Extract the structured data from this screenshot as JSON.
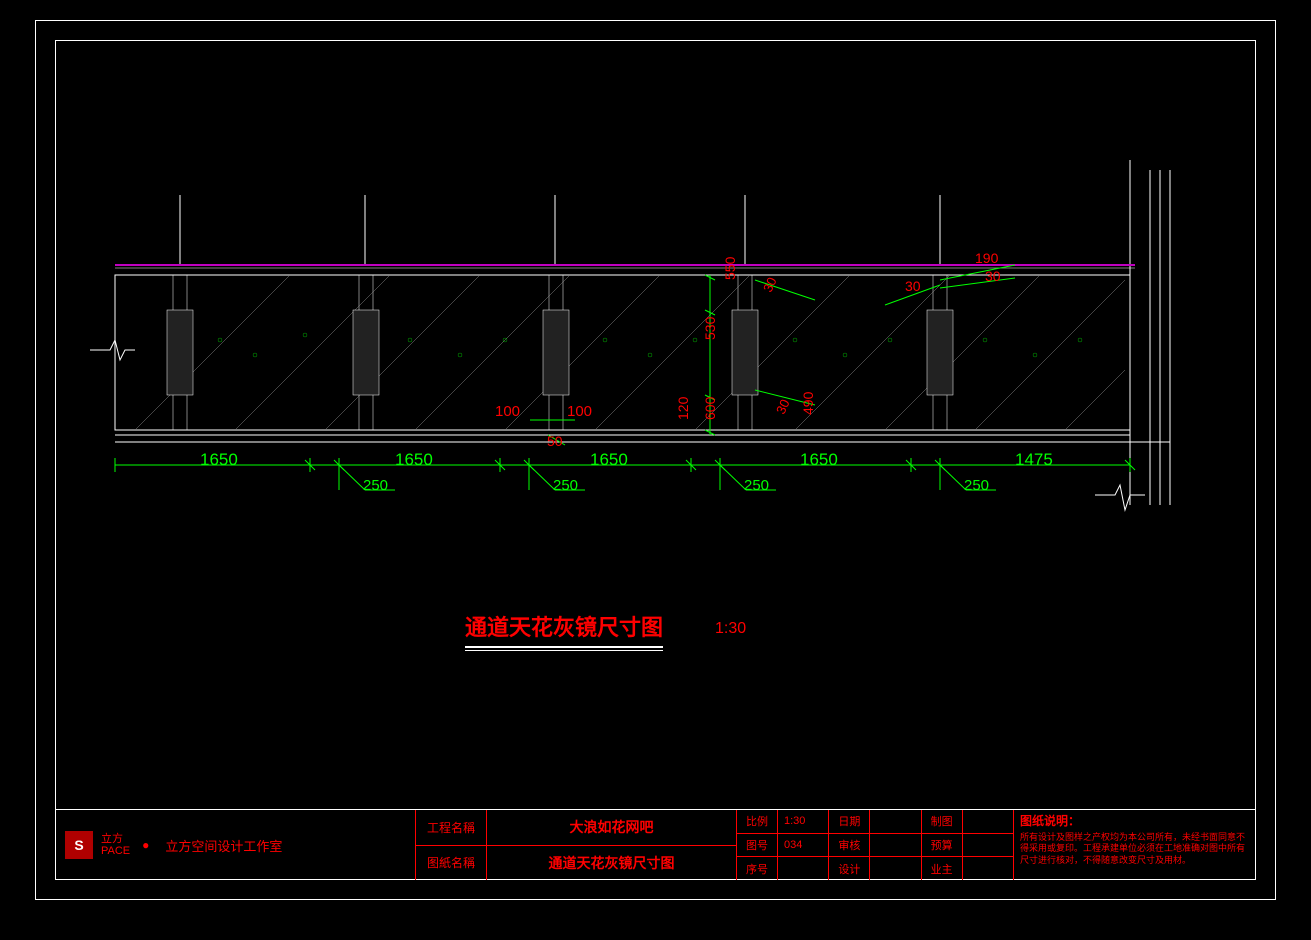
{
  "drawing_title": "通道天花灰镜尺寸图",
  "drawing_scale": "1:30",
  "dimensions": {
    "horizontal_bays": [
      "1650",
      "1650",
      "1650",
      "1650",
      "1475"
    ],
    "gaps": [
      "250",
      "250",
      "250",
      "250"
    ],
    "small_h1": "100",
    "small_h2": "100",
    "small_h3": "50",
    "v_top": "550",
    "v_mid": "530",
    "v_bot": "600",
    "v_120": "120",
    "v_30a": "30",
    "v_30b": "30",
    "v_30c": "30",
    "v_490": "490",
    "v_190": "190",
    "v_30d": "30"
  },
  "titleblock": {
    "studio_mark": "S",
    "studio_brand1": "立方",
    "studio_brand2": "PACE",
    "studio_line": "立方空间设计工作室",
    "project_name_label": "工程名稱",
    "project_name": "大浪如花网吧",
    "drawing_name_label": "图紙名稱",
    "drawing_name": "通道天花灰镜尺寸图",
    "cells": {
      "scale_label": "比例",
      "scale": "1:30",
      "drawing_no_label": "图号",
      "drawing_no": "034",
      "seq_label": "序号",
      "seq": "",
      "date_label": "日期",
      "date": "",
      "check_label": "审核",
      "check": "",
      "design_label": "设计",
      "design": "",
      "draft_label": "制图",
      "draft": "",
      "budget_label": "预算",
      "budget": "",
      "owner_label": "业主",
      "owner": ""
    },
    "notes_title": "图纸说明：",
    "notes_body": "所有设计及图样之产权均为本公司所有，未经书面同意不得采用或复印。工程承建单位必须在工地准确对图中所有尺寸进行核对，不得随意改变尺寸及用材。"
  }
}
